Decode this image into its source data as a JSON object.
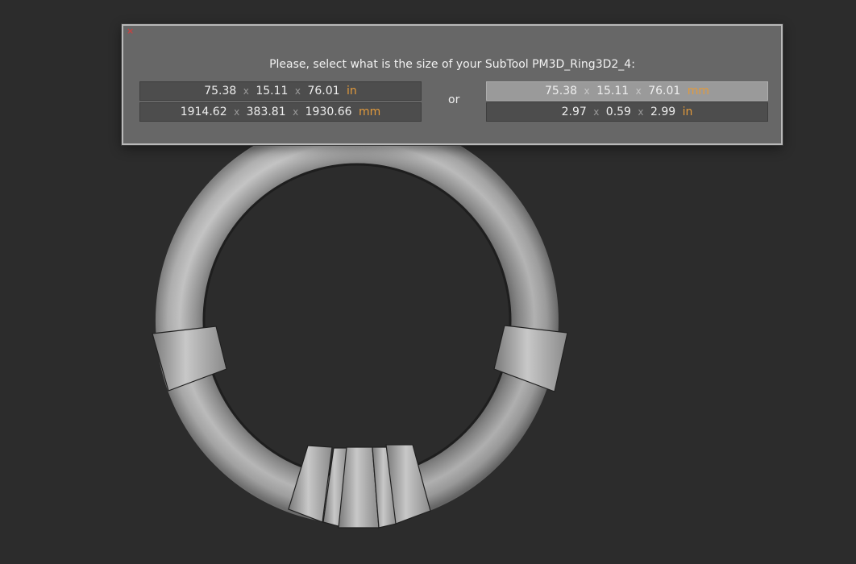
{
  "dialog": {
    "close_glyph": "×",
    "prompt": "Please, select what is the size of your SubTool PM3D_Ring3D2_4:",
    "or_label": "or",
    "separator": "x",
    "left_options": [
      {
        "a": "75.38",
        "b": "15.11",
        "c": "76.01",
        "unit": "in",
        "selected": false
      },
      {
        "a": "1914.62",
        "b": "383.81",
        "c": "1930.66",
        "unit": "mm",
        "selected": false
      }
    ],
    "right_options": [
      {
        "a": "75.38",
        "b": "15.11",
        "c": "76.01",
        "unit": "mm",
        "selected": true
      },
      {
        "a": "2.97",
        "b": "0.59",
        "c": "2.99",
        "unit": "in",
        "selected": false
      }
    ]
  },
  "viewport": {
    "object": "ring-3d-model"
  },
  "colors": {
    "background": "#2c2c2c",
    "dialog_bg": "#676767",
    "unit_accent": "#e29a3c",
    "close_red": "#c94040"
  }
}
